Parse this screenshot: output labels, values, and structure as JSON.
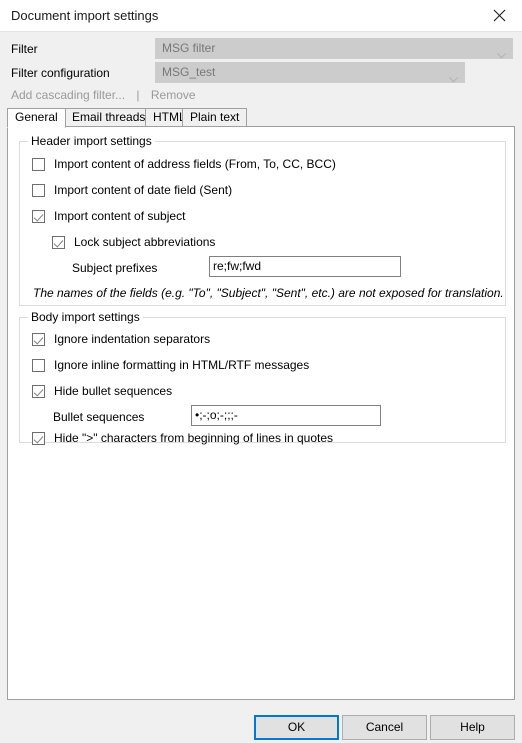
{
  "window": {
    "title": "Document import settings",
    "close_icon": "close-icon"
  },
  "form": {
    "filter_label": "Filter",
    "filter_value": "MSG filter",
    "filter_config_label": "Filter configuration",
    "filter_config_value": "MSG_test",
    "add_cascading_filter": "Add cascading filter...",
    "separator": "|",
    "remove": "Remove"
  },
  "tabs": [
    {
      "label": "General",
      "active": true
    },
    {
      "label": "Email threads",
      "active": false
    },
    {
      "label": "HTML",
      "active": false
    },
    {
      "label": "Plain text",
      "active": false
    }
  ],
  "header_group": {
    "title": "Header import settings",
    "checkboxes": [
      {
        "label": "Import content of address fields (From, To, CC, BCC)",
        "checked": false
      },
      {
        "label": "Import content of date field (Sent)",
        "checked": false
      },
      {
        "label": "Import content of subject",
        "checked": true
      },
      {
        "label": "Lock subject abbreviations",
        "checked": true
      }
    ],
    "subject_prefixes_label": "Subject prefixes",
    "subject_prefixes_value": "re;fw;fwd",
    "note": "The names of the fields (e.g. \"To\", \"Subject\", \"Sent\", etc.) are not exposed for translation."
  },
  "body_group": {
    "title": "Body import settings",
    "checkboxes": [
      {
        "label": "Ignore indentation separators",
        "checked": true
      },
      {
        "label": "Ignore inline formatting in HTML/RTF messages",
        "checked": false
      },
      {
        "label": "Hide bullet sequences",
        "checked": true
      },
      {
        "label": "Hide \">\" characters from beginning of lines in quotes",
        "checked": true
      }
    ],
    "bullet_sequences_label": "Bullet sequences",
    "bullet_sequences_value": "•;-;o;-;;;-"
  },
  "buttons": {
    "ok": "OK",
    "cancel": "Cancel",
    "help": "Help"
  },
  "colors": {
    "dialog_bg": "#f0f0f0",
    "panel_bg": "#ffffff",
    "accent": "#0078d7",
    "disabled_text": "#9a9a9a",
    "combo_bg": "#cccccc"
  }
}
